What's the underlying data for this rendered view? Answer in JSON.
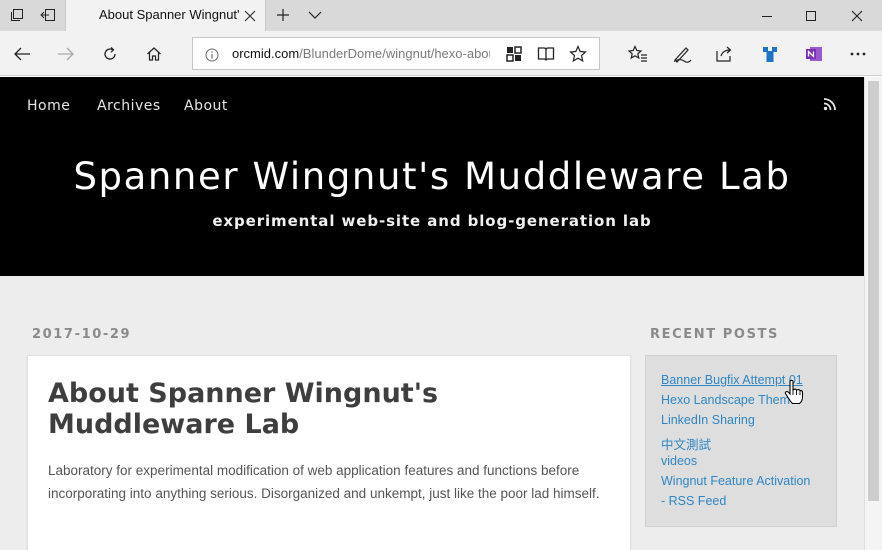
{
  "browser": {
    "tab": {
      "title": "About Spanner Wingnut's Muddleware Lab"
    },
    "address": {
      "domain": "orcmid.com",
      "path": "/BlunderDome/wingnut/hexo-about"
    },
    "icons": {
      "set_aside_tabs": "tabs-aside-icon",
      "restore_tabs": "restore-tabs-icon",
      "new_tab": "plus-icon",
      "tab_list": "chevron-down-icon",
      "back": "back-arrow-icon",
      "forward": "forward-arrow-icon",
      "refresh": "refresh-icon",
      "home": "home-icon",
      "site_info": "info-icon",
      "extension": "puzzle-icon",
      "reading_view": "book-icon",
      "favorite": "star-icon",
      "favorites_hub": "favorites-list-icon",
      "web_note": "pen-icon",
      "share": "share-icon",
      "ext_blue": "blue-extension-icon",
      "onenote": "onenote-icon",
      "more": "more-icon",
      "minimize": "minimize-icon",
      "maximize": "maximize-icon",
      "close": "close-icon"
    }
  },
  "site": {
    "nav": [
      "Home",
      "Archives",
      "About"
    ],
    "title": "Spanner Wingnut's Muddleware Lab",
    "subtitle": "experimental web-site and blog-generation lab"
  },
  "post": {
    "date": "2017-10-29",
    "title": "About Spanner Wingnut's Muddleware Lab",
    "body": "Laboratory for experimental modification of web application features and functions before incorporating into anything serious. Disorganized and unkempt, just like the poor lad himself."
  },
  "sidebar": {
    "title": "RECENT POSTS",
    "posts": [
      "Banner Bugfix Attempt 01",
      "Hexo Landscape Theme",
      "LinkedIn Sharing",
      "中文測試",
      "videos",
      "Wingnut Feature Activation",
      "- RSS Feed"
    ]
  },
  "colors": {
    "header_bg": "#000000",
    "link": "#2f86c4",
    "page_bg": "#ededed"
  }
}
